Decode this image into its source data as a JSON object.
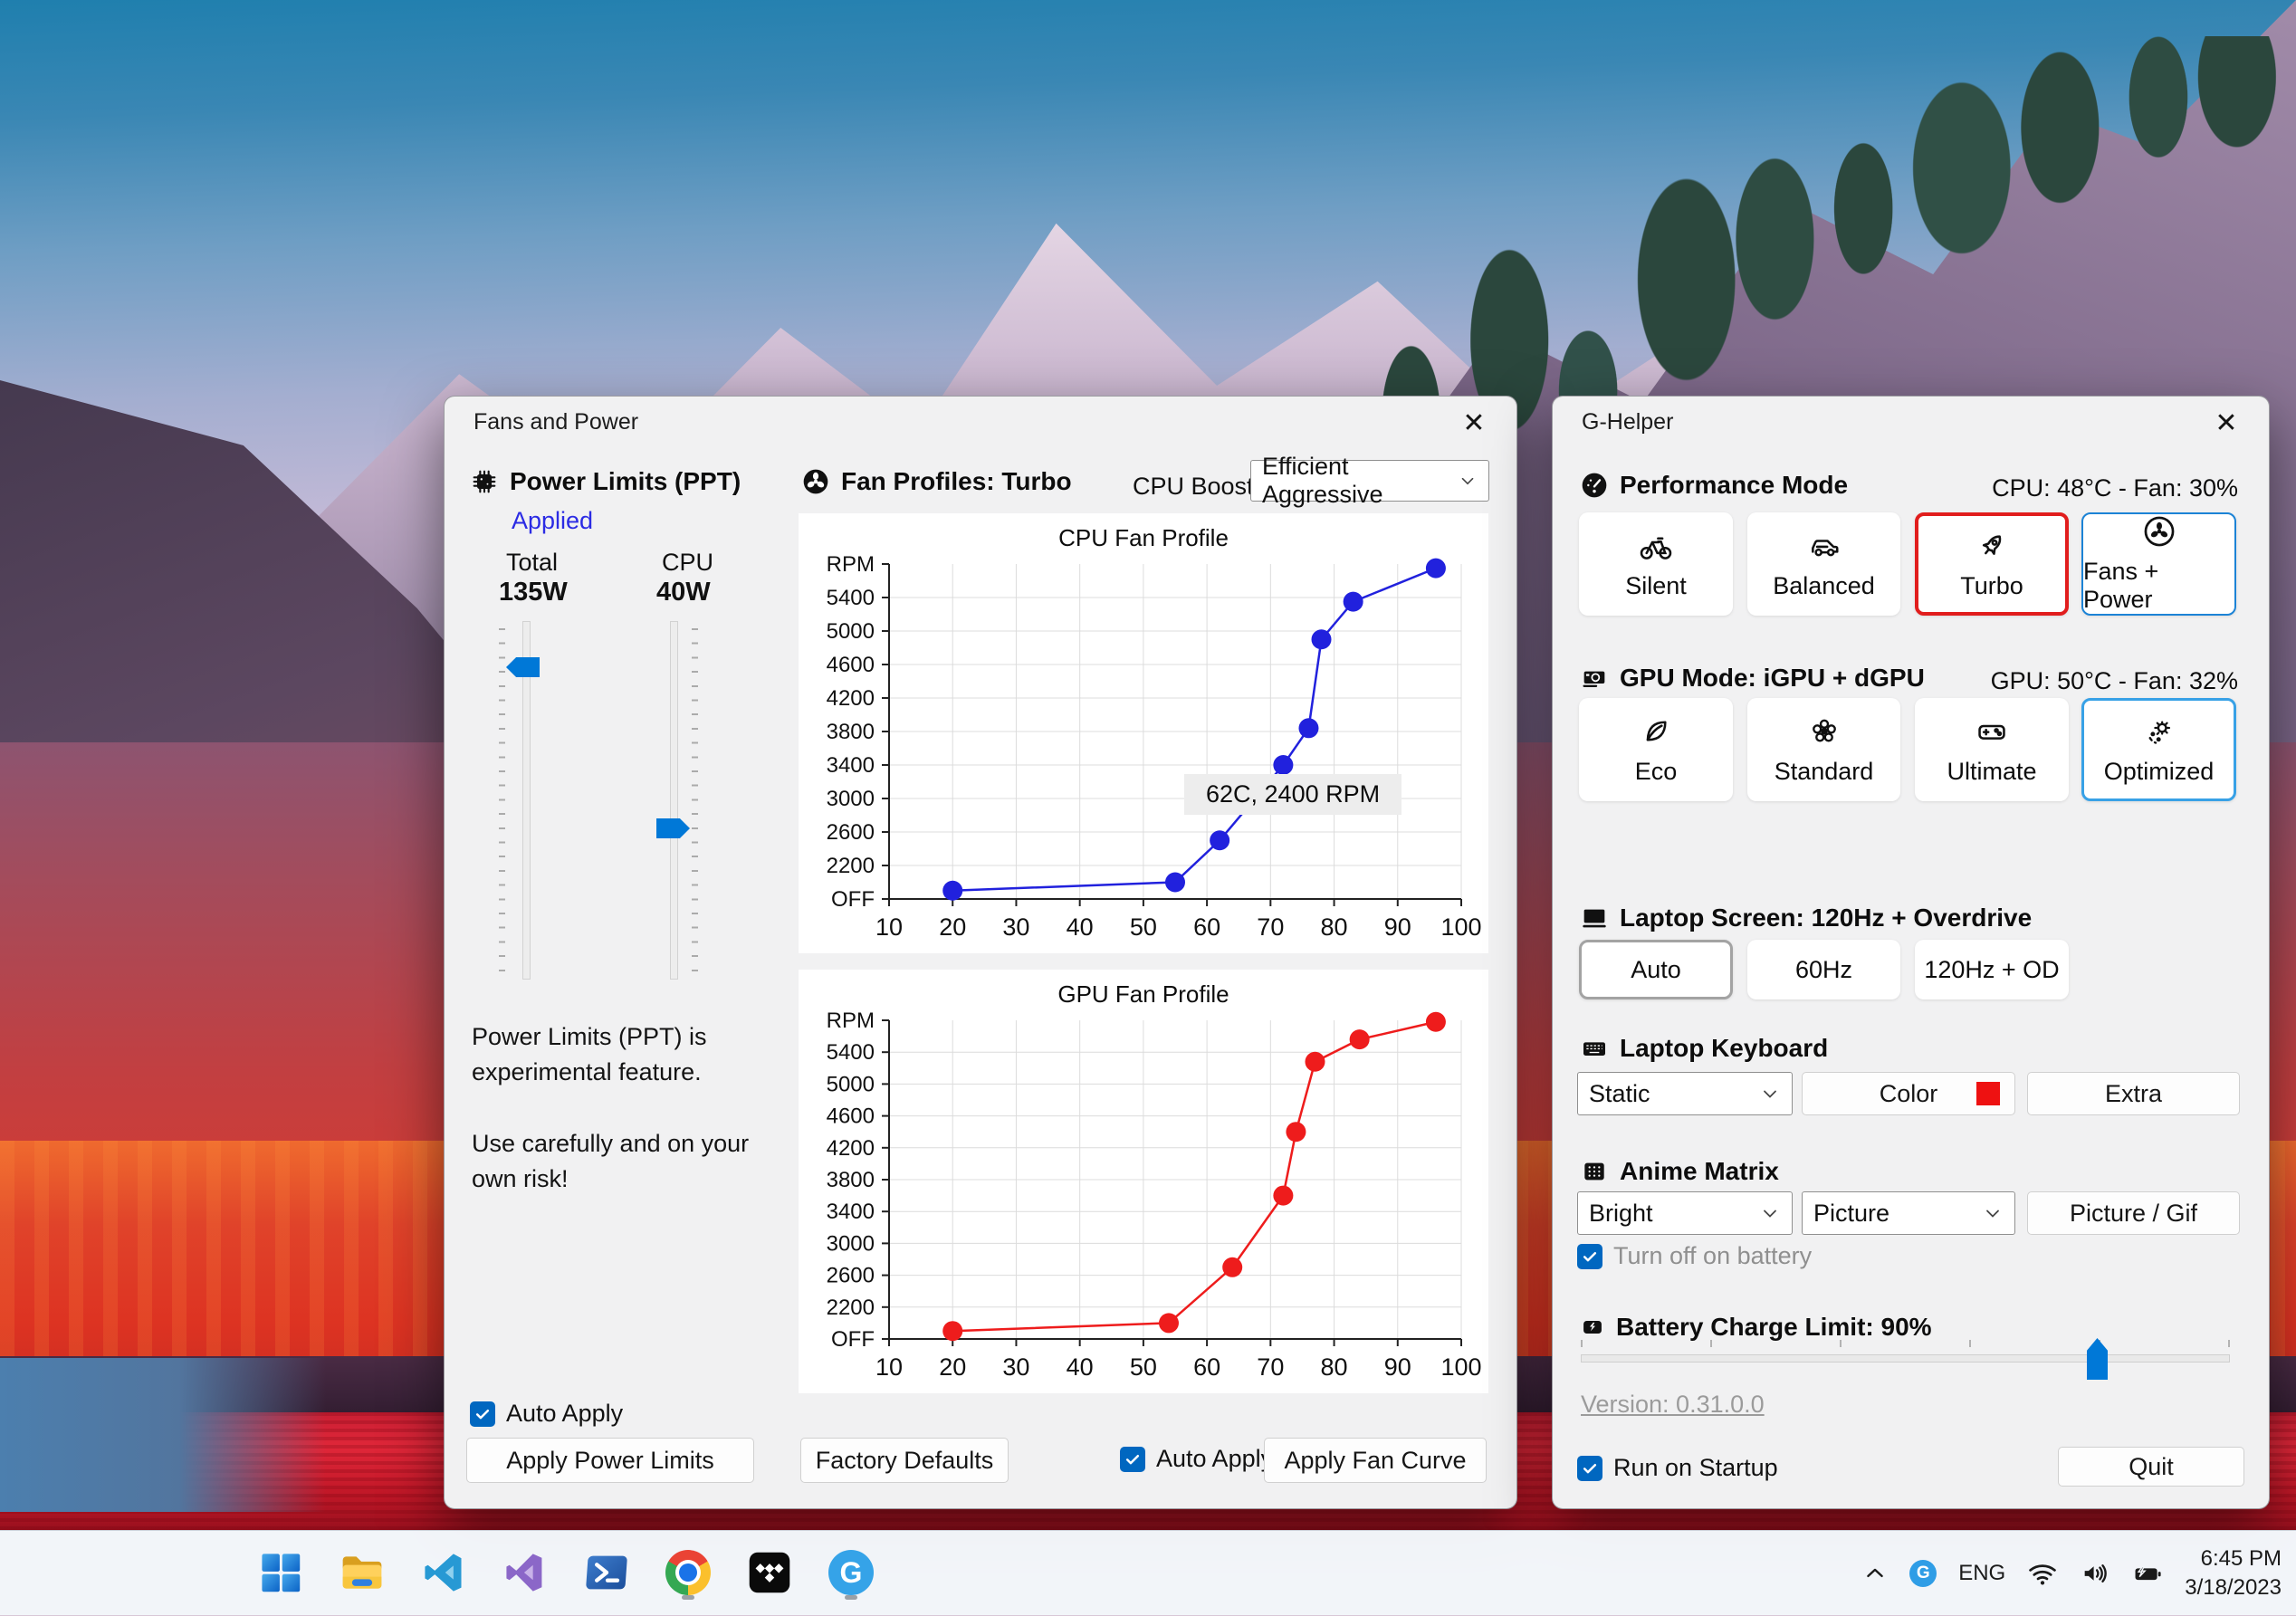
{
  "colors": {
    "accent": "#0067c0",
    "slider_thumb": "#0078d7",
    "turbo_selected_border": "#e11d1d",
    "optimized_selected_border": "#38a1e6",
    "cpu_line": "#2121dd",
    "gpu_line": "#ee1c1c",
    "keyboard_color_swatch": "#ee1111"
  },
  "fans_window": {
    "title": "Fans and Power",
    "close_glyph": "✕",
    "power": {
      "heading": "Power Limits (PPT)",
      "status": "Applied",
      "total_label": "Total",
      "total_value": "135W",
      "cpu_label": "CPU",
      "cpu_value": "40W",
      "warning1": "Power Limits (PPT) is experimental feature.",
      "warning2": "Use carefully and on your own risk!",
      "auto_apply_label": "Auto Apply",
      "apply_button": "Apply Power Limits"
    },
    "profiles": {
      "heading": "Fan Profiles: Turbo",
      "cpu_boost_label": "CPU Boost",
      "cpu_boost_value": "Efficient Aggressive",
      "factory_button": "Factory Defaults",
      "auto_apply_label": "Auto Apply",
      "apply_button": "Apply Fan Curve"
    }
  },
  "ghelper_window": {
    "title": "G-Helper",
    "close_glyph": "✕",
    "performance": {
      "heading": "Performance Mode",
      "status": "CPU: 48°C -  Fan: 30%",
      "silent": "Silent",
      "balanced": "Balanced",
      "turbo": "Turbo",
      "fans_power": "Fans + Power",
      "selected": "Turbo"
    },
    "gpu": {
      "heading": "GPU Mode: iGPU + dGPU",
      "status": "GPU: 50°C -  Fan: 32%",
      "eco": "Eco",
      "standard": "Standard",
      "ultimate": "Ultimate",
      "optimized": "Optimized",
      "selected": "Optimized"
    },
    "screen": {
      "heading": "Laptop Screen: 120Hz + Overdrive",
      "auto": "Auto",
      "hz60": "60Hz",
      "hz120": "120Hz + OD",
      "selected": "Auto"
    },
    "keyboard": {
      "heading": "Laptop Keyboard",
      "mode_value": "Static",
      "color_button": "Color",
      "extra_button": "Extra"
    },
    "matrix": {
      "heading": "Anime Matrix",
      "brightness_value": "Bright",
      "mode_value": "Picture",
      "picture_button": "Picture / Gif",
      "battery_checkbox_label": "Turn off on battery"
    },
    "battery": {
      "heading": "Battery Charge Limit: 90%"
    },
    "footer": {
      "version": "Version: 0.31.0.0",
      "startup_label": "Run on Startup",
      "quit_button": "Quit"
    }
  },
  "taskbar": {
    "icons": [
      "start",
      "file-explorer",
      "vscode",
      "visual-studio",
      "powershell",
      "chrome",
      "tidal",
      "g-helper"
    ],
    "g_letter": "G",
    "tray": {
      "language": "ENG",
      "time": "6:45 PM",
      "date": "3/18/2023"
    }
  },
  "chart_data": [
    {
      "type": "line",
      "title": "CPU Fan Profile",
      "color": "#2121dd",
      "x": [
        20,
        55,
        62,
        72,
        76,
        78,
        83,
        96
      ],
      "y": [
        1900,
        2000,
        2500,
        3400,
        3840,
        4900,
        5350,
        5750
      ],
      "xlabel": "",
      "ylabel": "RPM",
      "xlim": [
        10,
        100
      ],
      "xticks": [
        10,
        20,
        30,
        40,
        50,
        60,
        70,
        80,
        90,
        100
      ],
      "ytick_values": [
        1800,
        2200,
        2600,
        3000,
        3400,
        3800,
        4200,
        4600,
        5000,
        5400,
        5800
      ],
      "ytick_labels": [
        "OFF",
        "2200",
        "2600",
        "3000",
        "3400",
        "3800",
        "4200",
        "4600",
        "5000",
        "5400",
        "RPM"
      ],
      "grid": true,
      "legend": "none",
      "annotation": {
        "text": "62C, 2400 RPM",
        "x": 62,
        "y": 2400
      }
    },
    {
      "type": "line",
      "title": "GPU Fan Profile",
      "color": "#ee1c1c",
      "x": [
        20,
        54,
        64,
        72,
        74,
        77,
        84,
        96
      ],
      "y": [
        1900,
        2000,
        2700,
        3600,
        4400,
        5280,
        5560,
        5780
      ],
      "xlabel": "",
      "ylabel": "RPM",
      "xlim": [
        10,
        100
      ],
      "xticks": [
        10,
        20,
        30,
        40,
        50,
        60,
        70,
        80,
        90,
        100
      ],
      "ytick_values": [
        1800,
        2200,
        2600,
        3000,
        3400,
        3800,
        4200,
        4600,
        5000,
        5400,
        5800
      ],
      "ytick_labels": [
        "OFF",
        "2200",
        "2600",
        "3000",
        "3400",
        "3800",
        "4200",
        "4600",
        "5000",
        "5400",
        "RPM"
      ],
      "grid": true,
      "legend": "none"
    }
  ]
}
